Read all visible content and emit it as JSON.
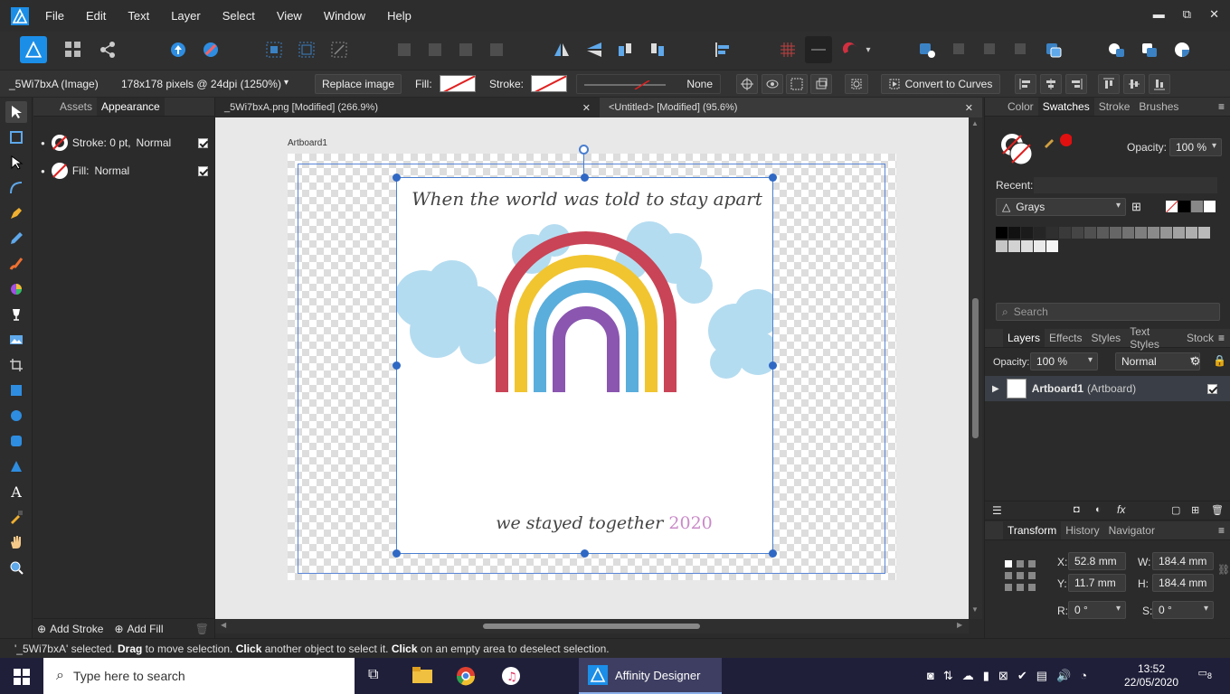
{
  "menubar": {
    "items": [
      "File",
      "Edit",
      "Text",
      "Layer",
      "Select",
      "View",
      "Window",
      "Help"
    ],
    "min": "▬",
    "max": "⧉",
    "close": "✕"
  },
  "context": {
    "layer_name": "_5Wi7bxA (Image)",
    "info": "178x178 pixels @ 24dpi (1250%)",
    "replace_image": "Replace image",
    "fill_label": "Fill:",
    "stroke_label": "Stroke:",
    "line_style": "None",
    "convert_curves": "Convert to Curves"
  },
  "left_panel": {
    "tabs": [
      "Assets",
      "Appearance"
    ],
    "stroke_label": "Stroke: 0 pt,",
    "stroke_mode": "Normal",
    "fill_label": "Fill:",
    "fill_mode": "Normal",
    "add_stroke": "Add Stroke",
    "add_fill": "Add Fill"
  },
  "doc_tabs": [
    {
      "title": "_5Wi7bxA.png [Modified] (266.9%)"
    },
    {
      "title": "<Untitled> [Modified] (95.6%)"
    }
  ],
  "canvas": {
    "artboard_label": "Artboard1",
    "text_top": "When the world was told to stay apart",
    "text_bottom": "we stayed together",
    "year": "2020"
  },
  "swatches_panel": {
    "tabs": [
      "Color",
      "Swatches",
      "Stroke",
      "Brushes"
    ],
    "opacity_label": "Opacity:",
    "opacity_value": "100 %",
    "recent_label": "Recent:",
    "palette": "Grays",
    "search_placeholder": "Search"
  },
  "layers_panel": {
    "tabs": [
      "Layers",
      "Effects",
      "Styles",
      "Text Styles",
      "Stock"
    ],
    "opacity_label": "Opacity:",
    "opacity_value": "100 %",
    "blend": "Normal",
    "layer_name": "Artboard1",
    "layer_type": "(Artboard)"
  },
  "transform_panel": {
    "tabs": [
      "Transform",
      "History",
      "Navigator"
    ],
    "x_label": "X:",
    "x": "52.8 mm",
    "y_label": "Y:",
    "y": "11.7 mm",
    "w_label": "W:",
    "w": "184.4 mm",
    "h_label": "H:",
    "h": "184.4 mm",
    "r_label": "R:",
    "r": "0 °",
    "s_label": "S:",
    "s": "0 °"
  },
  "status": {
    "name": "'_5Wi7bxA' selected.",
    "drag": "Drag",
    "t1": " to move selection. ",
    "click": "Click",
    "t2": " another object to select it. ",
    "click2": "Click",
    "t3": " on an empty area to deselect selection."
  },
  "taskbar": {
    "search_placeholder": "Type here to search",
    "active_app": "Affinity Designer",
    "time": "13:52",
    "date": "22/05/2020",
    "notifications": "8"
  },
  "colors": {
    "accent": "#3b82c4",
    "selection": "#4a7fd0",
    "stroke_none": "#e02020"
  }
}
